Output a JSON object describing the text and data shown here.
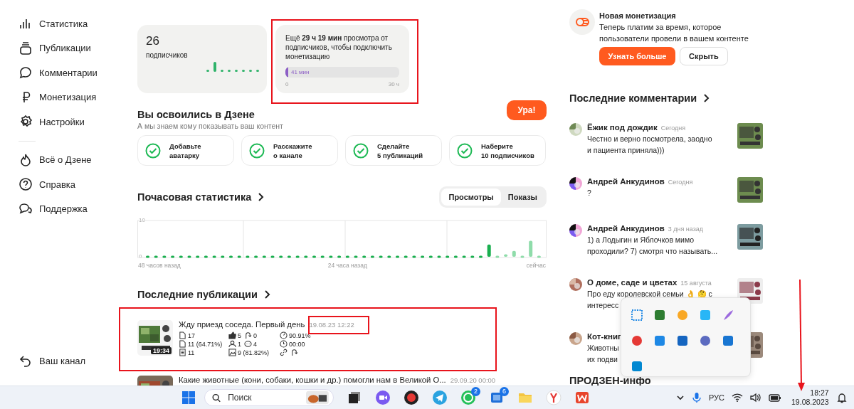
{
  "sidebar": {
    "sections": [
      [
        {
          "kind": "stats",
          "label": "Статистика"
        },
        {
          "kind": "publications",
          "label": "Публикации"
        },
        {
          "kind": "comments",
          "label": "Комментарии"
        },
        {
          "kind": "ruble",
          "label": "Монетизация"
        },
        {
          "kind": "gear",
          "label": "Настройки"
        }
      ],
      [
        {
          "kind": "flame",
          "label": "Всё о Дзене"
        },
        {
          "kind": "help",
          "label": "Справка"
        },
        {
          "kind": "support",
          "label": "Поддержка"
        }
      ]
    ],
    "footer": {
      "kind": "back",
      "label": "Ваш канал"
    }
  },
  "subscribers": {
    "count": "26",
    "label": "подписчиков"
  },
  "monetization_progress": {
    "text": "Ещё **29 ч 19 мин** просмотра от подписчиков, чтобы подключить монетизацию",
    "level": 0.023,
    "value_label": "41 мин",
    "min_label": "0",
    "max_label": "30 ч"
  },
  "onboarding": {
    "title": "Вы освоились в Дзене",
    "subtitle": "А мы знаем кому показывать ваш контент",
    "button": "Ура!",
    "tasks": [
      {
        "lines": [
          "Добавьте",
          "аватарку"
        ],
        "checked": true
      },
      {
        "lines": [
          "Расскажите",
          "о канале"
        ],
        "checked": true
      },
      {
        "lines": [
          "Сделайте",
          "5 публикаций"
        ],
        "checked": true
      },
      {
        "lines": [
          "Наберите",
          "10 подписчиков"
        ],
        "checked": true
      }
    ]
  },
  "hourly_stats": {
    "title": "Почасовая статистика",
    "tabs": [
      {
        "label": "Просмотры",
        "selected": true
      },
      {
        "label": "Показы",
        "selected": false
      }
    ],
    "chart_data": {
      "type": "bar",
      "categories": [
        "48 часов назад",
        null,
        null,
        null,
        null,
        null,
        null,
        null,
        null,
        null,
        null,
        null,
        null,
        null,
        null,
        null,
        null,
        null,
        null,
        null,
        null,
        null,
        null,
        null,
        "24 часа назад",
        null,
        null,
        null,
        null,
        null,
        null,
        null,
        null,
        null,
        null,
        null,
        null,
        null,
        null,
        null,
        null,
        null,
        null,
        null,
        null,
        null,
        null,
        "сейчас"
      ],
      "ylim": [
        0,
        10
      ],
      "yticks": [
        0,
        10
      ],
      "series": [
        {
          "color": "#1aaf4f",
          "values": [
            0,
            0,
            0,
            0,
            0,
            0,
            0,
            0,
            0,
            0,
            0,
            0,
            0,
            0,
            0,
            0,
            0,
            0,
            0,
            0,
            0,
            0,
            0,
            0,
            0,
            0,
            0,
            0,
            0,
            0,
            0,
            0,
            0,
            0,
            0,
            0,
            0,
            0,
            0,
            0,
            0,
            3.4,
            null,
            null,
            null,
            null,
            null,
            null
          ]
        },
        {
          "color": "#8fdcaa",
          "values": [
            null,
            null,
            null,
            null,
            null,
            null,
            null,
            null,
            null,
            null,
            null,
            null,
            null,
            null,
            null,
            null,
            null,
            null,
            null,
            null,
            null,
            null,
            null,
            null,
            null,
            null,
            null,
            null,
            null,
            null,
            null,
            null,
            null,
            null,
            null,
            null,
            null,
            null,
            null,
            null,
            null,
            null,
            0,
            0.7,
            1.6,
            0,
            4.4,
            0
          ]
        }
      ]
    }
  },
  "publications": {
    "title": "Последние публикации",
    "rows": [
      {
        "title": "Жду приезд соседа. Первый день",
        "date": "19.08.23 12:22",
        "duration": "19:34",
        "stats": [
          [
            {
              "kind": "views",
              "value": "17"
            }
          ],
          [
            {
              "kind": "likes",
              "value": "5"
            },
            {
              "kind": "reposts",
              "value": "0"
            }
          ],
          [
            {
              "kind": "rate",
              "value": "90.91%"
            }
          ],
          [
            {
              "kind": "reads",
              "value": "11 (64.71%)"
            }
          ],
          [
            {
              "kind": "subscribers",
              "value": "1"
            },
            {
              "kind": "comments",
              "value": "4"
            }
          ],
          [
            {
              "kind": "time",
              "value": "00:00"
            }
          ],
          [
            {
              "kind": "text",
              "value": "11"
            }
          ],
          [
            {
              "kind": "images",
              "value": "9 (81.82%)"
            }
          ],
          [
            {
              "kind": "link"
            },
            {
              "kind": "reposts"
            }
          ]
        ]
      },
      {
        "title": "Какие животные (кони, собаки, кошки и др.) помогли нам в Великой О...",
        "date": "29.09.20 00:00"
      }
    ]
  },
  "promo": {
    "title": "Новая монетизация",
    "text": "Теперь платим за время, которое пользователи провели в вашем контенте",
    "buttons": [
      {
        "label": "Узнать больше",
        "kind": "primary"
      },
      {
        "label": "Скрыть",
        "kind": "secondary"
      }
    ]
  },
  "comments": {
    "title": "Последние комментарии",
    "items": [
      {
        "author": "Ёжик под дождик",
        "time": "Сегодня",
        "lines": [
          "Честно и верно посмотрела, заодно",
          "и пациента приняла)))"
        ]
      },
      {
        "author": "Андрей Анкудинов",
        "time": "Сегодня",
        "lines": [
          "?"
        ]
      },
      {
        "author": "Андрей Анкудинов",
        "time": "3 дня назад",
        "lines": [
          "1) а Лодыгин и Яблочков мимо",
          "проходили? 7) смотря что называть..."
        ]
      },
      {
        "author": "О доме, саде и цветах",
        "time": "15 августа",
        "lines": [
          "Про еду королевской семьи 👌 🤔 с",
          "интересс"
        ]
      },
      {
        "author": "Кот-книг",
        "lines": [
          "Животны",
          "их подви"
        ]
      }
    ]
  },
  "prozen": {
    "title": "ПРОДЗЕН-инфо"
  },
  "taskbar": {
    "search_placeholder": "Поиск",
    "apps": [
      {
        "kind": "windows"
      },
      {
        "kind": "camera"
      },
      {
        "kind": "record"
      },
      {
        "kind": "plane"
      },
      {
        "kind": "chat",
        "badge": "2"
      },
      {
        "kind": "phone",
        "badge": "6"
      },
      {
        "kind": "folder"
      },
      {
        "kind": "letter-y"
      },
      {
        "kind": "letter-w"
      }
    ],
    "language": "РУС",
    "time": "18:27",
    "date": "19.08.2023"
  }
}
